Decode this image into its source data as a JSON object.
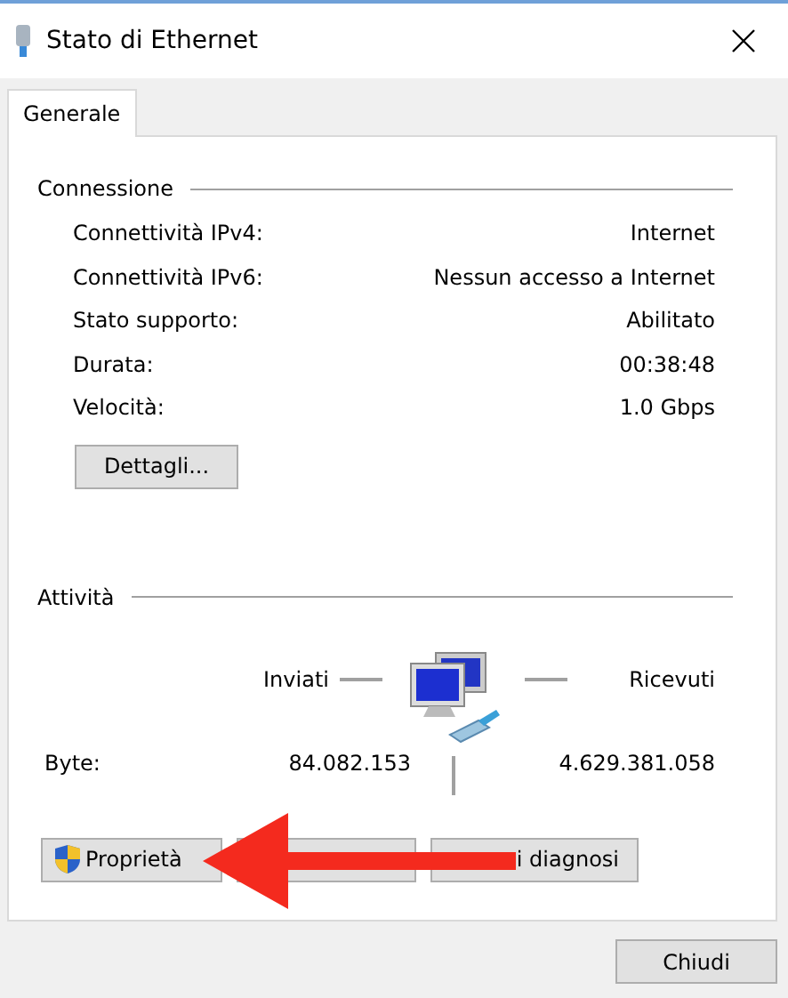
{
  "window": {
    "title": "Stato di Ethernet"
  },
  "tabs": [
    {
      "label": "Generale",
      "selected": true
    }
  ],
  "connection": {
    "heading": "Connessione",
    "rows": [
      {
        "label": "Connettività IPv4:",
        "value": "Internet"
      },
      {
        "label": "Connettività IPv6:",
        "value": "Nessun accesso a Internet"
      },
      {
        "label": "Stato supporto:",
        "value": "Abilitato"
      },
      {
        "label": "Durata:",
        "value": "00:38:48"
      },
      {
        "label": "Velocità:",
        "value": "1.0 Gbps"
      }
    ],
    "details_button": "Dettagli..."
  },
  "activity": {
    "heading": "Attività",
    "sent_label": "Inviati",
    "received_label": "Ricevuti",
    "bytes_label": "Byte:",
    "sent": "84.082.153",
    "received": "4.629.381.058"
  },
  "buttons": [
    {
      "label": "Proprietà",
      "kind": "shield"
    },
    {
      "kind": "covered"
    },
    {
      "label": "i diagnosi",
      "kind": "partial"
    }
  ],
  "close_button": "Chiudi"
}
